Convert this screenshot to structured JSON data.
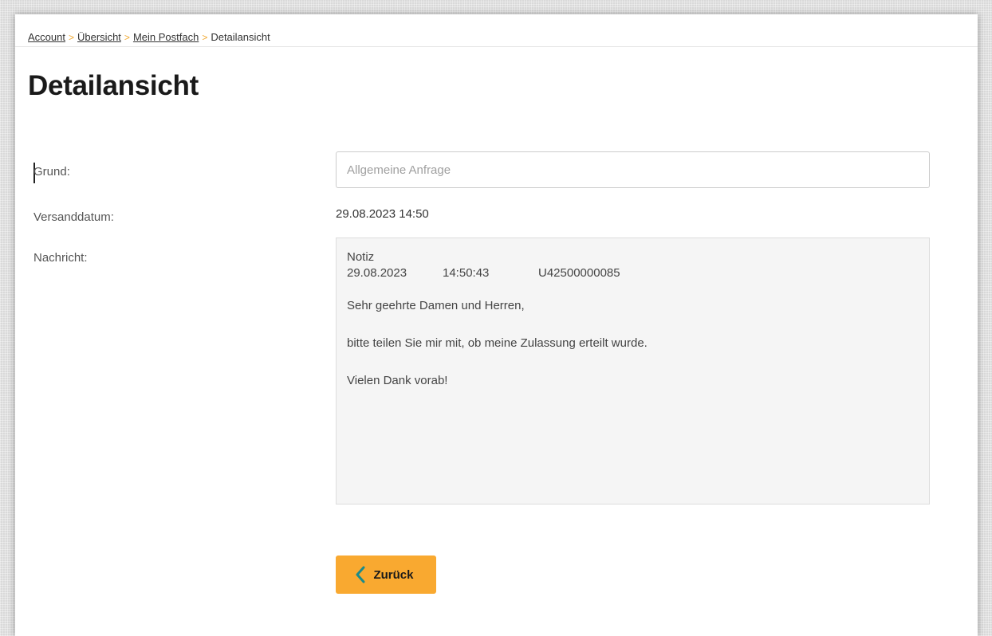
{
  "breadcrumb": {
    "items": [
      "Account",
      "Übersicht",
      "Mein Postfach"
    ],
    "separator": ">",
    "current": "Detailansicht"
  },
  "page": {
    "title": "Detailansicht"
  },
  "form": {
    "grund": {
      "label": "Grund:",
      "placeholder": "Allgemeine Anfrage"
    },
    "versanddatum": {
      "label": "Versanddatum:",
      "value": "29.08.2023 14:50"
    },
    "nachricht": {
      "label": "Nachricht:",
      "type_label": "Notiz",
      "date": "29.08.2023",
      "time": "14:50:43",
      "reference": "U42500000085",
      "greeting": "Sehr geehrte Damen und Herren,",
      "body": "bitte teilen Sie mir mit, ob meine Zulassung erteilt wurde.",
      "closing": "Vielen Dank vorab!"
    }
  },
  "actions": {
    "back_label": "Zurück"
  },
  "colors": {
    "accent": "#f9a930",
    "chevron": "#1a8a8a",
    "breadcrumb_separator": "#f0a830"
  },
  "icons": {
    "back": "chevron-left-icon"
  }
}
